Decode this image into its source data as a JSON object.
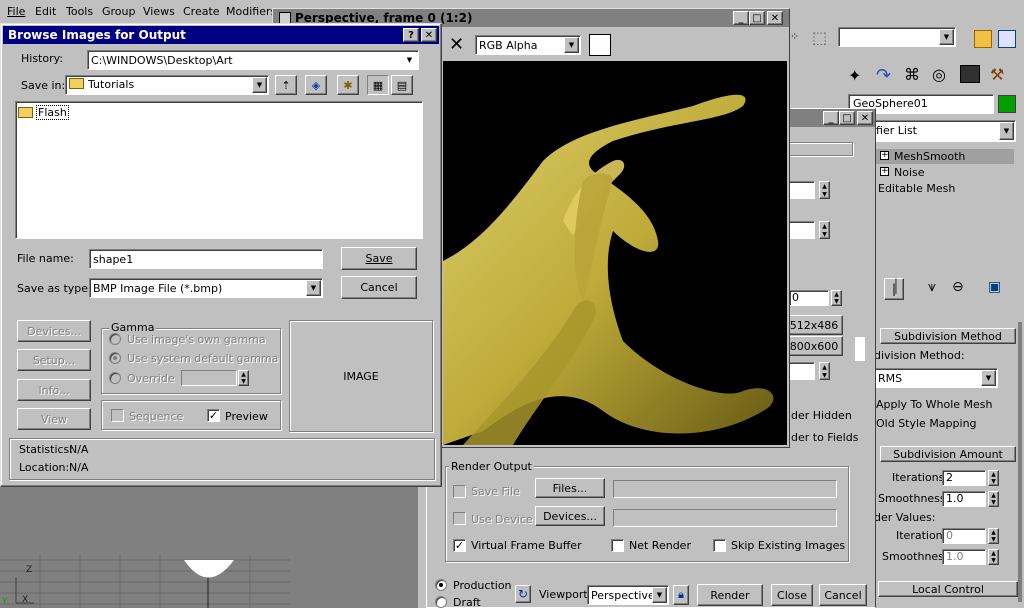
{
  "menu": [
    "File",
    "Edit",
    "Tools",
    "Group",
    "Views",
    "Create",
    "Modifiers"
  ],
  "browse_dialog": {
    "title": "Browse Images for Output",
    "history_label": "History:",
    "history_value": "C:\\WINDOWS\\Desktop\\Art",
    "save_in_label": "Save in:",
    "save_in_value": "Tutorials",
    "files": [
      "Flash"
    ],
    "file_name_label": "File name:",
    "file_name_value": "shape1",
    "save_as_type_label": "Save as type:",
    "save_as_type_value": "BMP Image File (*.bmp)",
    "save_button": "Save",
    "cancel_button": "Cancel",
    "devices_button": "Devices...",
    "setup_button": "Setup...",
    "info_button": "Info...",
    "view_button": "View",
    "gamma_label": "Gamma",
    "gamma_own": "Use image's own gamma",
    "gamma_default": "Use system default gamma",
    "gamma_override": "Override",
    "sequence_label": "Sequence",
    "preview_label": "Preview",
    "image_placeholder": "IMAGE",
    "statistics_label": "Statistics:",
    "statistics_value": "N/A",
    "location_label": "Location:",
    "location_value": "N/A"
  },
  "frame_window": {
    "title": "Perspective, frame 0 (1:2)",
    "channel": "RGB Alpha"
  },
  "render_panel": {
    "res1": "512x486",
    "res2": "800x600",
    "field0": "0",
    "render_hidden": "der Hidden",
    "render_fields": "der to Fields",
    "render_output_label": "Render Output",
    "save_file": "Save File",
    "files_button": "Files...",
    "use_device": "Use Device",
    "devices_button": "Devices...",
    "virtual_frame_buffer": "Virtual Frame Buffer",
    "net_render": "Net Render",
    "skip_existing": "Skip Existing Images",
    "production": "Production",
    "draft": "Draft",
    "viewport_label": "Viewport:",
    "viewport_value": "Perspective",
    "render_button": "Render",
    "close_button": "Close",
    "cancel_button": "Cancel"
  },
  "command_panel": {
    "object_name": "GeoSphere01",
    "modifier_list": "ifier List",
    "stack": [
      "MeshSmooth",
      "Noise",
      "Editable Mesh"
    ],
    "subdivision_method_header": "Subdivision Method",
    "subdivision_method_label": "division Method:",
    "subdivision_method_value": "RMS",
    "apply_whole_mesh": "Apply To Whole Mesh",
    "old_style_mapping": "Old Style Mapping",
    "subdivision_amount_header": "Subdivision Amount",
    "iterations_label": "Iterations:",
    "iterations_value": "2",
    "smoothness_label": "Smoothness:",
    "smoothness_value": "1.0",
    "render_values_label": "der Values:",
    "r_iterations_label": "Iterations:",
    "r_iterations_value": "0",
    "r_smoothness_label": "Smoothness:",
    "r_smoothness_value": "1.0",
    "local_control_header": "Local Control"
  },
  "viewport_axes": {
    "z": "Z",
    "x": "X",
    "y": "Y"
  },
  "colors": {
    "title_active": "#000080",
    "title_inactive": "#808080",
    "render_bg": "#000000",
    "object": "#c8b43c",
    "swatch": "#ffffff",
    "object_color": "#00a000"
  }
}
